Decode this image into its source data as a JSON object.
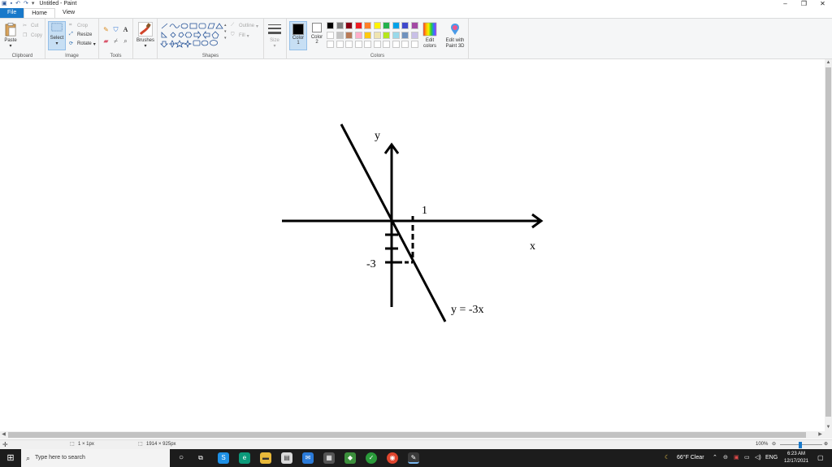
{
  "window": {
    "title": "Untitled - Paint",
    "controls": {
      "minimize": "–",
      "restore": "❐",
      "close": "✕"
    }
  },
  "tabs": [
    {
      "label": "File"
    },
    {
      "label": "Home"
    },
    {
      "label": "View"
    }
  ],
  "ribbon": {
    "clipboard": {
      "label": "Clipboard",
      "paste": "Paste",
      "cut": "Cut",
      "copy": "Copy"
    },
    "image": {
      "label": "Image",
      "select": "Select",
      "crop": "Crop",
      "resize": "Resize",
      "rotate": "Rotate"
    },
    "tools": {
      "label": "Tools"
    },
    "brushes": {
      "label": "Brushes"
    },
    "shapes": {
      "label": "Shapes",
      "outline": "Outline",
      "fill": "Fill"
    },
    "size": {
      "label": "Size"
    },
    "colors": {
      "label": "Colors",
      "color1_label": "Color",
      "color1_num": "1",
      "color2_label": "Color",
      "color2_num": "2",
      "edit_colors": "Edit colors",
      "edit_with_paint3d": "Edit with Paint 3D",
      "color1": "#000000",
      "color2": "#ffffff",
      "palette_row1": [
        "#000000",
        "#7f7f7f",
        "#880015",
        "#ed1c24",
        "#ff7f27",
        "#fff200",
        "#22b14c",
        "#00a2e8",
        "#3f48cc",
        "#a349a4"
      ],
      "palette_row2": [
        "#ffffff",
        "#c3c3c3",
        "#b97a57",
        "#ffaec9",
        "#ffc90e",
        "#efe4b0",
        "#b5e61d",
        "#99d9ea",
        "#7092be",
        "#c8bfe7"
      ],
      "palette_row3": [
        "#ffffff",
        "#ffffff",
        "#ffffff",
        "#ffffff",
        "#ffffff",
        "#ffffff",
        "#ffffff",
        "#ffffff",
        "#ffffff",
        "#ffffff"
      ]
    }
  },
  "drawing": {
    "y_label": "y",
    "x_label": "x",
    "tick_x": "1",
    "tick_y": "-3",
    "equation": "y = -3x"
  },
  "status": {
    "selection_size": "1 × 1px",
    "image_size": "1914 × 925px",
    "zoom": "100%"
  },
  "taskbar": {
    "search_placeholder": "Type here to search",
    "weather": "66°F  Clear",
    "language": "ENG",
    "time": "6:23 AM",
    "date": "12/17/2021"
  }
}
